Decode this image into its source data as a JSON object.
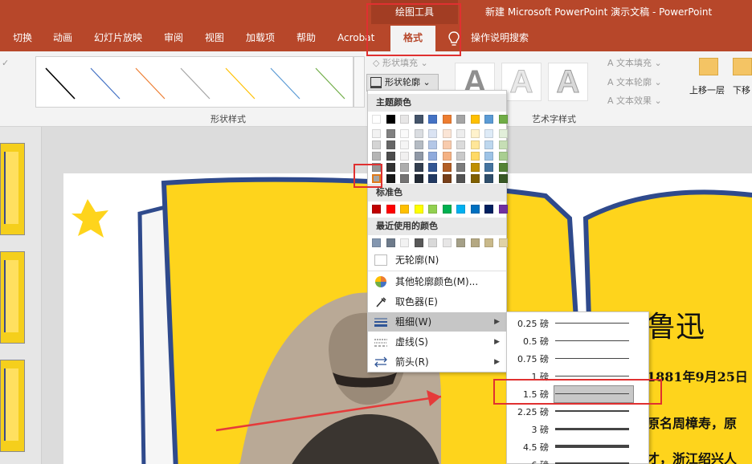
{
  "titlebar": {
    "context_group": "绘图工具",
    "document_title": "新建 Microsoft PowerPoint 演示文稿  -  PowerPoint"
  },
  "tabs": [
    "切换",
    "动画",
    "幻灯片放映",
    "审阅",
    "视图",
    "加载项",
    "帮助",
    "Acrobat",
    "格式"
  ],
  "tell_me": "操作说明搜索",
  "ribbon": {
    "shape_styles_label": "形状样式",
    "shape_fill": "形状填充",
    "shape_outline": "形状轮廓",
    "wordart_label": "艺术字样式",
    "text_fill": "文本填充",
    "text_outline": "文本轮廓",
    "text_effects": "文本效果",
    "bring_forward": "上移一层",
    "send_backward": "下移"
  },
  "outline_menu": {
    "theme_colors_header": "主题颜色",
    "standard_colors_header": "标准色",
    "recent_colors_header": "最近使用的颜色",
    "no_outline": "无轮廓(N)",
    "more_colors": "其他轮廓颜色(M)...",
    "eyedropper": "取色器(E)",
    "weight": "粗细(W)",
    "dashes": "虚线(S)",
    "arrows": "箭头(R)",
    "theme_top_row": [
      "#ffffff",
      "#000000",
      "#e7e6e6",
      "#44546a",
      "#4472c4",
      "#ed7d31",
      "#a5a5a5",
      "#ffc000",
      "#5b9bd5",
      "#70ad47"
    ],
    "standard_colors": [
      "#c00000",
      "#ff0000",
      "#ffc000",
      "#ffff00",
      "#92d050",
      "#00b050",
      "#00b0f0",
      "#0070c0",
      "#002060",
      "#7030a0"
    ],
    "recent_colors": [
      "#8497b0",
      "#6e7b8b",
      "#f2f2f2",
      "#595959",
      "#d9d9d9",
      "#e7e6e6",
      "#a5a088",
      "#b4a882",
      "#c9b98a",
      "#e0d2a6"
    ]
  },
  "weight_submenu": [
    {
      "label": "0.25 磅",
      "weight": 0.25
    },
    {
      "label": "0.5 磅",
      "weight": 0.5
    },
    {
      "label": "0.75 磅",
      "weight": 0.75
    },
    {
      "label": "1 磅",
      "weight": 1
    },
    {
      "label": "1.5 磅",
      "weight": 1.5,
      "selected": true
    },
    {
      "label": "2.25 磅",
      "weight": 2.25
    },
    {
      "label": "3 磅",
      "weight": 3
    },
    {
      "label": "4.5 磅",
      "weight": 4.5
    },
    {
      "label": "6 磅",
      "weight": 6
    }
  ],
  "slide": {
    "title": "鲁迅",
    "line1": "1881年9月25日",
    "line2": "原名周樟寿，原",
    "line3": "才，浙江绍兴人"
  },
  "colors": {
    "accent": "#b7472a",
    "annotation": "#e03030",
    "slide_yellow": "#fed41c",
    "book_outline": "#2f4a8c"
  }
}
